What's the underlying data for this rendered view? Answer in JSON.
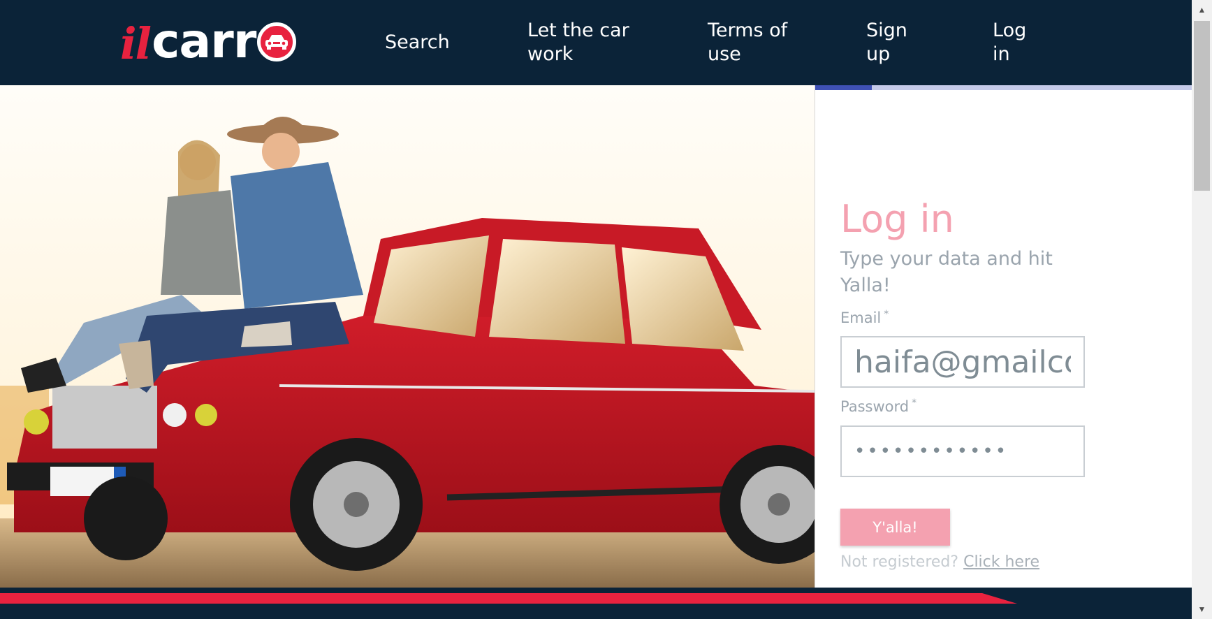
{
  "header": {
    "logo": {
      "il": "il",
      "carr": "carr"
    },
    "nav": [
      {
        "label": "Search"
      },
      {
        "label": "Let the car work"
      },
      {
        "label": "Terms of use"
      },
      {
        "label": "Sign up"
      },
      {
        "label": "Log in"
      }
    ]
  },
  "login": {
    "title": "Log in",
    "subtitle": "Type your data and hit Yalla!",
    "email": {
      "label": "Email",
      "required_mark": "*",
      "value": "haifa@gmailcom"
    },
    "password": {
      "label": "Password",
      "required_mark": "*",
      "value": "••••••••••••"
    },
    "submit_label": "Y'alla!",
    "register_prompt": "Not registered?",
    "register_link": "Click here"
  },
  "progress": {
    "fraction": 0.15
  },
  "colors": {
    "navy": "#0b2338",
    "brand_red": "#e8223f",
    "pink": "#f4a1b0",
    "muted_text": "#9aa4ad",
    "progress_fill": "#3f51b5",
    "progress_track": "#c5cae9"
  },
  "hero_image": {
    "icon": "red-car-photo"
  }
}
